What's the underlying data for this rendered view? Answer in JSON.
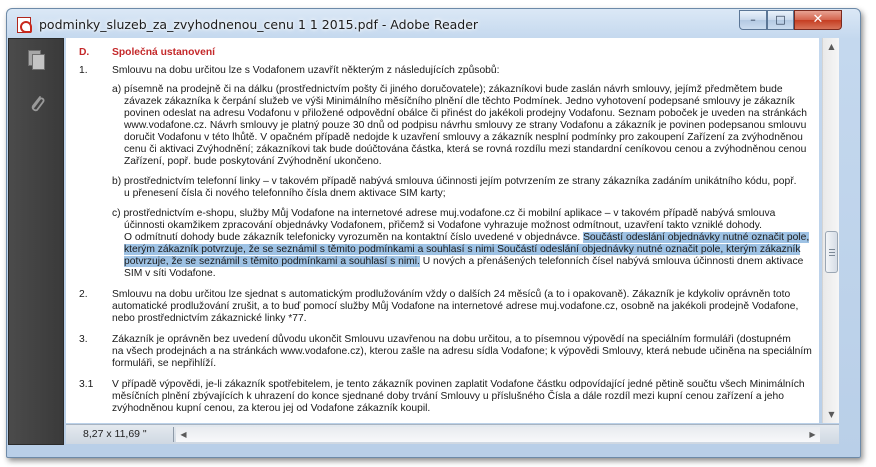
{
  "window": {
    "title": "podminky_sluzeb_za_zvyhodnenou_cenu 1 1 2015.pdf - Adobe Reader",
    "minimize_label": "–",
    "maximize_label": "□",
    "close_label": "✕"
  },
  "sidebar": {
    "pages_icon": "pages-icon",
    "attachments_icon": "paperclip-icon"
  },
  "document": {
    "section_letter": "D.",
    "section_title": "Společná ustanovení",
    "items": [
      {
        "num": "1.",
        "text": "Smlouvu na dobu určitou lze s Vodafonem uzavřít některým z následujících způsobů:"
      }
    ],
    "lines": [
      "a)  písemně na prodejně či na dálku (prostřednictvím pošty či jiného doručovatele); zákazníkovi bude zaslán návrh smlouvy, jejímž předmětem bude",
      "závazek zákazníka k čerpání služeb ve výši Minimálního měsíčního plnění dle těchto Podmínek. Jedno vyhotovení podepsané smlouvy je zákazník",
      "povinen odeslat na adresu Vodafonu v přiložené odpovědní obálce či přinést do jakékoli prodejny Vodafonu. Seznam poboček je uveden na stránkách",
      "www.vodafone.cz. Návrh smlouvy je platný pouze 30 dnů od podpisu návrhu smlouvy ze strany Vodafonu a zákazník je povinen podepsanou smlouvu",
      "doručit Vodafonu v této lhůtě. V opačném případě nedojde k uzavření smlouvy a zákazník nesplní podmínky pro zakoupení Zařízení za zvýhodněnou",
      "cenu či aktivaci Zvýhodnění; zákazníkovi tak bude doúčtována částka, která se rovná rozdílu mezi standardní ceníkovou cenou a zvýhodněnou cenou",
      "Zařízení, popř. bude poskytování Zvýhodnění ukončeno.",
      "b)  prostřednictvím telefonní linky – v takovém případě nabývá smlouva účinnosti jejím potvrzením ze strany zákazníka zadáním unikátního kódu, popř.",
      "u přenesení čísla či nového telefonního čísla dnem aktivace SIM karty;",
      "c)  prostřednictvím e-shopu, služby Můj Vodafone na internetové adrese muj.vodafone.cz či mobilní aplikace – v takovém případě nabývá smlouva",
      "účinnosti okamžikem zpracování objednávky Vodafonem, přičemž si Vodafone vyhrazuje možnost odmítnout, uzavření takto vzniklé dohody.",
      "O odmítnutí dohody bude zákazník telefonicky vyrozuměn na kontaktní číslo uvedené v objednávce. ",
      "Součástí odeslání objednávky nutné označit pole,",
      "kterým zákazník potvrzuje, že se seznámil s těmito podmínkami a souhlasí s nimi Součástí odeslání objednávky nutné označit pole, kterým zákazník",
      "potvrzuje, že se seznámil s těmito podmínkami a souhlasí s nimi.",
      " U nových a přenášených telefonních čísel nabývá smlouva účinnosti dnem aktivace",
      "SIM v síti Vodafone."
    ],
    "item2_num": "2.",
    "item2_lines": [
      "Smlouvu na dobu určitou lze sjednat s automatickým prodlužováním vždy o dalších 24 měsíců (a to i opakovaně). Zákazník je kdykoliv oprávněn toto",
      "automatické prodlužování zrušit, a to buď pomocí služby Můj Vodafone na internetové adrese muj.vodafone.cz,  osobně na jakékoli prodejně Vodafone,",
      "nebo prostřednictvím zákaznické linky *77."
    ],
    "item3_num": "3.",
    "item3_lines": [
      "Zákazník je oprávněn bez uvedení důvodu ukončit Smlouvu uzavřenou na dobu určitou, a to písemnou výpovědí na speciálním formuláři (dostupném",
      "na všech prodejnách a na stránkách www.vodafone.cz), kterou zašle na adresu sídla Vodafone; k výpovědi Smlouvy, která nebude učiněna na speciálním",
      "formuláři, se nepřihlíží."
    ],
    "item31_num": "3.1",
    "item31_lines": [
      "V případě výpovědi, je-li zákazník spotřebitelem, je tento zákazník    povinen zaplatit Vodafone částku odpovídající jedné pětině součtu všech Minimálních",
      "měsíčních plnění zbývajících k uhrazení do konce sjednané doby trvání Smlouvy u příslušného Čísla a dále rozdíl mezi kupní cenou zařízení a jeho",
      "zvýhodněnou kupní cenou, za kterou jej od Vodafone zákazník koupil."
    ]
  },
  "statusbar": {
    "page_size": "8,27 x 11,69 \""
  },
  "colors": {
    "selection": "#9ec2e4",
    "section_title": "#c4282a",
    "sidebar": "#3f3f3f"
  }
}
